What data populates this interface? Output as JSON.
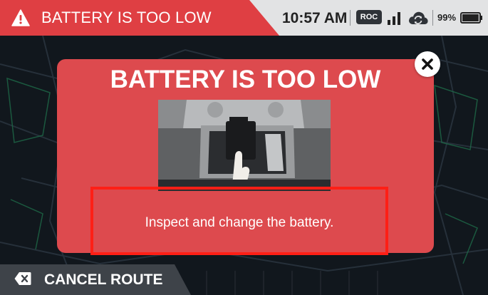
{
  "status_bar": {
    "alert_title": "BATTERY IS TOO LOW",
    "time": "10:57 AM",
    "mode_badge": "ROC",
    "battery_percent": "99%",
    "battery_level": 0.99,
    "icons": [
      "warning-icon",
      "signal-icon",
      "cloud-sync-icon",
      "battery-icon"
    ]
  },
  "modal": {
    "title": "BATTERY IS TOO LOW",
    "instruction": "Inspect and change the battery.",
    "close_icon": "close-icon"
  },
  "bottom": {
    "cancel_route_label": "CANCEL ROUTE",
    "cancel_icon": "backspace-x-icon"
  },
  "colors": {
    "alert_red": "#df3f43",
    "modal_red": "#dd4a4e",
    "highlight_red": "#ff1f16",
    "status_bar_gray": "#e2e3e4",
    "cancel_bar": "#3e4349"
  }
}
